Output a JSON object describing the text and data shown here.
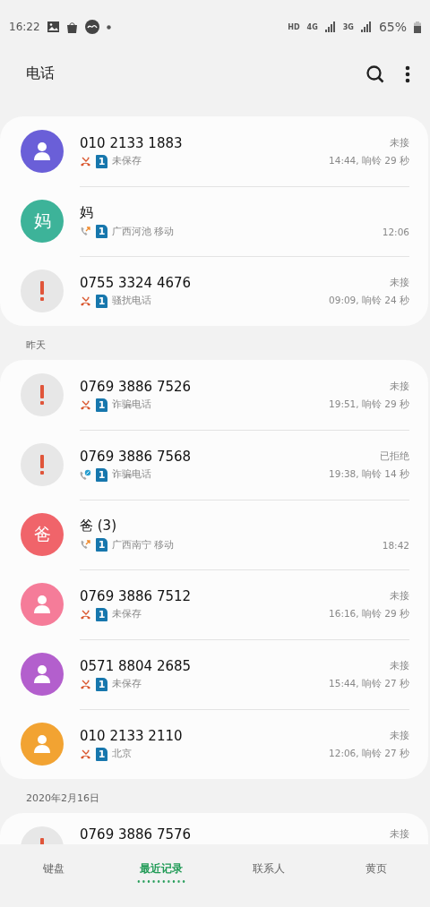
{
  "status_bar": {
    "time": "16:22",
    "hd": "HD",
    "net_1": "4G",
    "net_2": "3G",
    "battery": "65%"
  },
  "header": {
    "title": "电话"
  },
  "sections": [
    {
      "rows": [
        {
          "avatar": {
            "kind": "person",
            "color": "#6a5fd8"
          },
          "name": "010 2133 1883",
          "call_icon": {
            "kind": "missed"
          },
          "sim": "1",
          "detail": "未保存",
          "status": "未接",
          "time": "14:44, 响铃 29 秒"
        },
        {
          "avatar": {
            "kind": "letter",
            "color": "#3db399",
            "letter": "妈"
          },
          "name": "妈",
          "call_icon": {
            "kind": "outgoing"
          },
          "sim": "1",
          "detail": "广西河池 移动",
          "time": "12:06"
        },
        {
          "avatar": {
            "kind": "alert",
            "color": "#e7e7e7"
          },
          "name": "0755 3324 4676",
          "call_icon": {
            "kind": "missed"
          },
          "sim": "1",
          "detail": "骚扰电话",
          "status": "未接",
          "time": "09:09, 响铃 24 秒"
        }
      ]
    },
    {
      "label": "昨天",
      "rows": [
        {
          "avatar": {
            "kind": "alert",
            "color": "#e7e7e7"
          },
          "name": "0769 3886 7526",
          "call_icon": {
            "kind": "missed"
          },
          "sim": "1",
          "detail": "诈骗电话",
          "status": "未接",
          "time": "19:51, 响铃 29 秒"
        },
        {
          "avatar": {
            "kind": "alert",
            "color": "#e7e7e7"
          },
          "name": "0769 3886 7568",
          "call_icon": {
            "kind": "rejected"
          },
          "sim": "1",
          "detail": "诈骗电话",
          "status": "已拒绝",
          "time": "19:38, 响铃 14 秒"
        },
        {
          "avatar": {
            "kind": "letter",
            "color": "#f0646a",
            "letter": "爸"
          },
          "name": "爸 (3)",
          "call_icon": {
            "kind": "outgoing"
          },
          "sim": "1",
          "detail": "广西南宁 移动",
          "time": "18:42"
        },
        {
          "avatar": {
            "kind": "person",
            "color": "#f57c99"
          },
          "name": "0769 3886 7512",
          "call_icon": {
            "kind": "missed"
          },
          "sim": "1",
          "detail": "未保存",
          "status": "未接",
          "time": "16:16, 响铃 29 秒"
        },
        {
          "avatar": {
            "kind": "person",
            "color": "#b35fcd"
          },
          "name": "0571 8804 2685",
          "call_icon": {
            "kind": "missed"
          },
          "sim": "1",
          "detail": "未保存",
          "status": "未接",
          "time": "15:44, 响铃 27 秒"
        },
        {
          "avatar": {
            "kind": "person",
            "color": "#f2a332"
          },
          "name": "010 2133 2110",
          "call_icon": {
            "kind": "missed"
          },
          "sim": "1",
          "detail": "北京",
          "status": "未接",
          "time": "12:06, 响铃 27 秒"
        }
      ]
    },
    {
      "label": "2020年2月16日",
      "partial": true,
      "rows": [
        {
          "avatar": {
            "kind": "alert",
            "color": "#e7e7e7"
          },
          "name": "0769 3886 7576",
          "status": "未接"
        }
      ]
    }
  ],
  "tabs": [
    {
      "label": "键盘",
      "selected": false
    },
    {
      "label": "最近记录",
      "selected": true
    },
    {
      "label": "联系人",
      "selected": false
    },
    {
      "label": "黄页",
      "selected": false
    }
  ]
}
